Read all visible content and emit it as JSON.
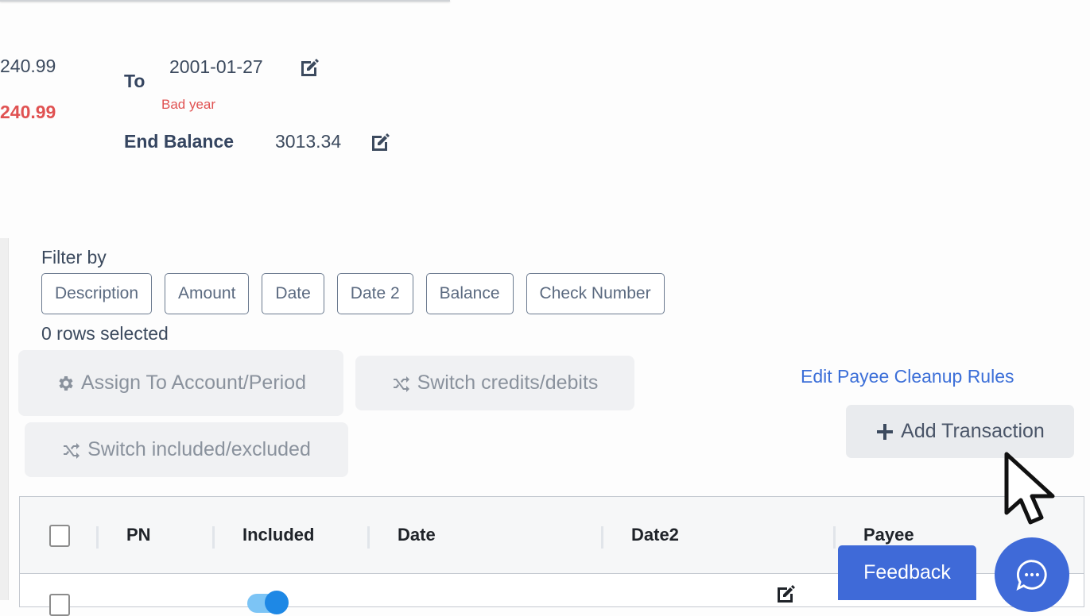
{
  "summary": {
    "start_balance_partial": "240.99",
    "difference_partial": "240.99",
    "to_label": "To",
    "to_date": "2001-01-27",
    "to_error": "Bad year",
    "end_balance_label": "End Balance",
    "end_balance_value": "3013.34"
  },
  "filter": {
    "label": "Filter by",
    "options": [
      "Description",
      "Amount",
      "Date",
      "Date 2",
      "Balance",
      "Check Number"
    ],
    "rows_selected": "0 rows selected"
  },
  "actions": {
    "assign": "Assign To Account/Period",
    "switch_credits": "Switch credits/debits",
    "switch_included": "Switch included/excluded",
    "edit_payee_rules": "Edit Payee Cleanup Rules",
    "add_transaction": "Add Transaction"
  },
  "table": {
    "columns": [
      "PN",
      "Included",
      "Date",
      "Date2",
      "Payee"
    ],
    "rows": [
      {
        "selected": false,
        "included": true
      }
    ]
  },
  "widgets": {
    "feedback": "Feedback"
  },
  "colors": {
    "error": "#e05252",
    "link": "#3c6fd8",
    "primary": "#3f6ad8",
    "toggle_on": "#1e88e5"
  }
}
